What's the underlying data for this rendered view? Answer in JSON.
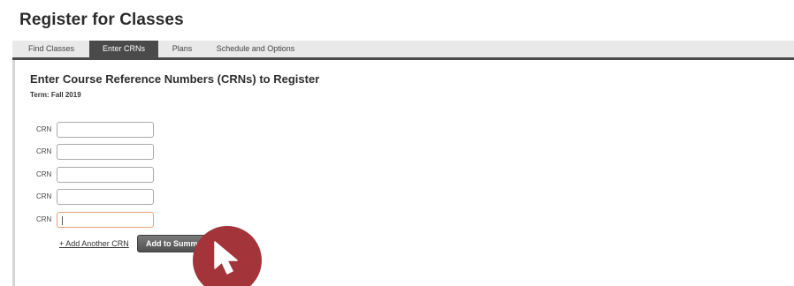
{
  "header": {
    "title": "Register for Classes"
  },
  "tabs": [
    {
      "label": "Find Classes",
      "active": false
    },
    {
      "label": "Enter CRNs",
      "active": true
    },
    {
      "label": "Plans",
      "active": false
    },
    {
      "label": "Schedule and Options",
      "active": false
    }
  ],
  "main": {
    "section_title": "Enter Course Reference Numbers (CRNs) to Register",
    "term": "Term: Fall 2019",
    "crn_rows": [
      {
        "label": "CRN",
        "value": ""
      },
      {
        "label": "CRN",
        "value": ""
      },
      {
        "label": "CRN",
        "value": ""
      },
      {
        "label": "CRN",
        "value": ""
      },
      {
        "label": "CRN",
        "value": "",
        "focused": true
      }
    ],
    "add_link": "+ Add Another CRN",
    "submit_label": "Add to Summary"
  },
  "overlay": {
    "icon": "cursor-arrow-icon",
    "color": "#a3343a"
  },
  "colors": {
    "active_tab": "#4a4a4a",
    "tab_bar": "#e9e9e9",
    "badge": "#a3343a"
  }
}
